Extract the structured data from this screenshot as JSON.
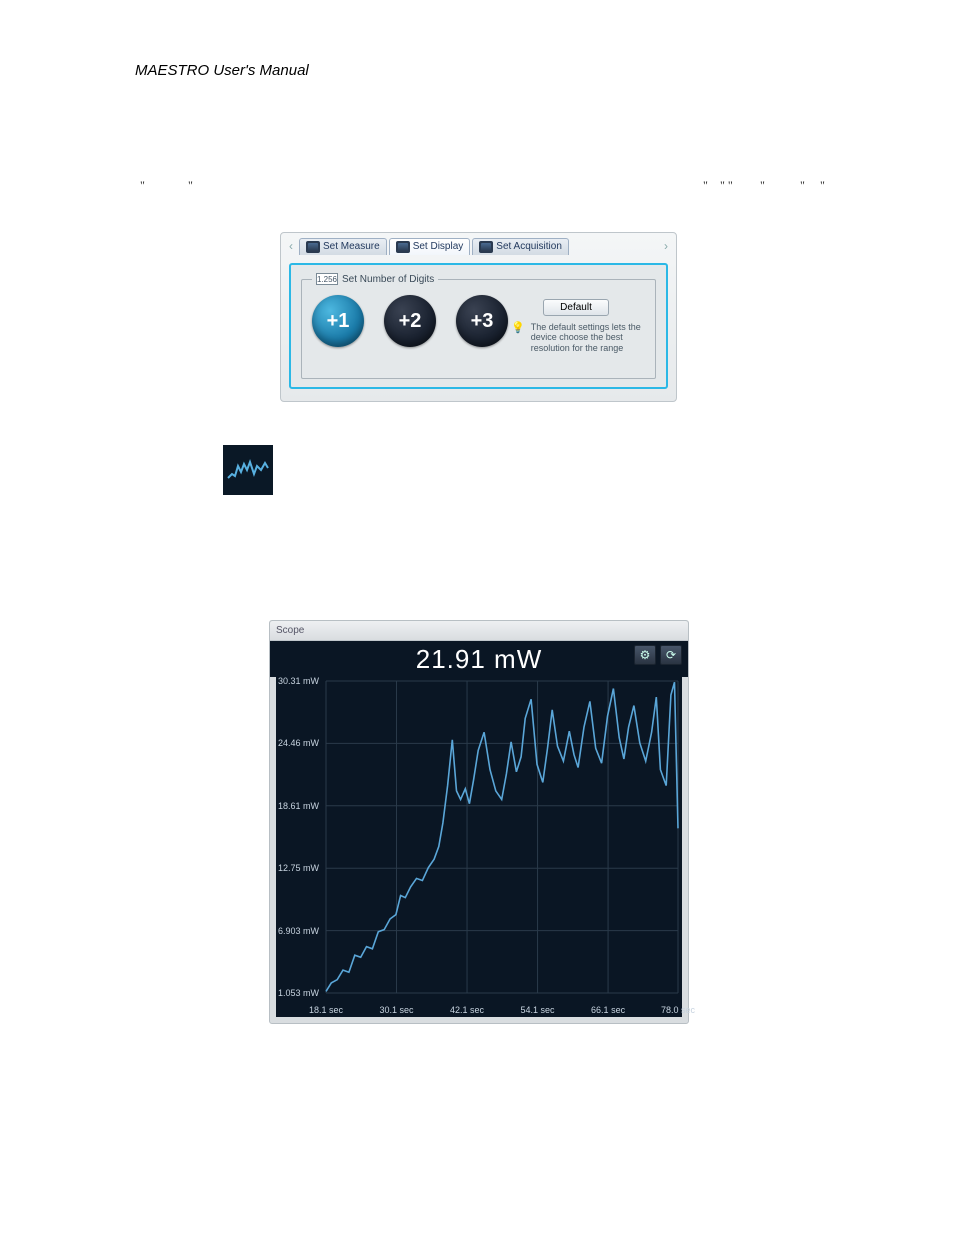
{
  "header": {
    "title": "MAESTRO User's Manual"
  },
  "quotes": {
    "left1": "\"",
    "left2": "\"",
    "r1": "\"",
    "r2": "\"  \"",
    "r3": "\"",
    "r4": "\"",
    "r5": "\""
  },
  "panel": {
    "arrow_left": "‹",
    "arrow_right": "›",
    "tabs": [
      {
        "label": "Set Measure"
      },
      {
        "label": "Set Display"
      },
      {
        "label": "Set Acquisition"
      }
    ],
    "legend_badge": "1.256",
    "legend_text": "Set Number of Digits",
    "options": [
      "+1",
      "+2",
      "+3"
    ],
    "default_label": "Default",
    "hint": "The default settings lets the device choose the best resolution for the range"
  },
  "scope": {
    "title": "Scope",
    "reading": "21.91 mW",
    "btn1_name": "gear-icon",
    "btn2_name": "refresh-icon"
  },
  "chart_data": {
    "type": "line",
    "title": "Scope",
    "xlabel": "sec",
    "ylabel": "mW",
    "xlim": [
      18.1,
      78.0
    ],
    "ylim": [
      1.053,
      30.31
    ],
    "y_ticks": [
      30.31,
      24.46,
      18.61,
      12.75,
      6.903,
      1.053
    ],
    "y_tick_unit": "mW",
    "x_ticks": [
      18.1,
      30.1,
      42.1,
      54.1,
      66.1,
      78.0
    ],
    "x_tick_unit": "sec",
    "x": [
      18.1,
      19.0,
      20.0,
      21.0,
      22.0,
      23.0,
      24.0,
      25.0,
      26.0,
      27.0,
      28.0,
      29.0,
      30.0,
      30.8,
      31.6,
      32.5,
      33.5,
      34.5,
      35.5,
      36.5,
      37.3,
      38.0,
      38.8,
      39.6,
      40.3,
      41.0,
      41.8,
      42.5,
      43.2,
      44.0,
      45.0,
      46.0,
      47.0,
      48.0,
      48.8,
      49.6,
      50.5,
      51.3,
      52.0,
      53.0,
      54.0,
      55.0,
      55.8,
      56.6,
      57.5,
      58.5,
      59.5,
      60.3,
      61.0,
      62.0,
      63.0,
      64.0,
      65.0,
      66.0,
      67.0,
      68.0,
      68.8,
      69.6,
      70.5,
      71.5,
      72.5,
      73.5,
      74.3,
      75.0,
      76.0,
      76.8,
      77.4,
      78.0
    ],
    "values": [
      1.2,
      2.0,
      2.3,
      3.2,
      3.0,
      4.6,
      4.4,
      5.4,
      5.2,
      6.8,
      7.0,
      8.0,
      8.4,
      10.2,
      10.0,
      11.0,
      11.8,
      11.6,
      12.8,
      13.6,
      14.8,
      17.0,
      20.5,
      24.8,
      20.0,
      19.2,
      20.2,
      18.8,
      21.0,
      23.8,
      25.5,
      22.0,
      20.0,
      19.2,
      21.6,
      24.6,
      21.8,
      23.2,
      26.8,
      28.6,
      22.5,
      20.8,
      24.0,
      27.6,
      24.2,
      22.8,
      25.6,
      23.4,
      22.2,
      26.0,
      28.4,
      24.0,
      22.6,
      27.0,
      29.6,
      25.0,
      23.0,
      26.0,
      28.0,
      24.5,
      22.8,
      25.5,
      28.8,
      22.0,
      20.5,
      29.0,
      30.2,
      16.5
    ]
  }
}
